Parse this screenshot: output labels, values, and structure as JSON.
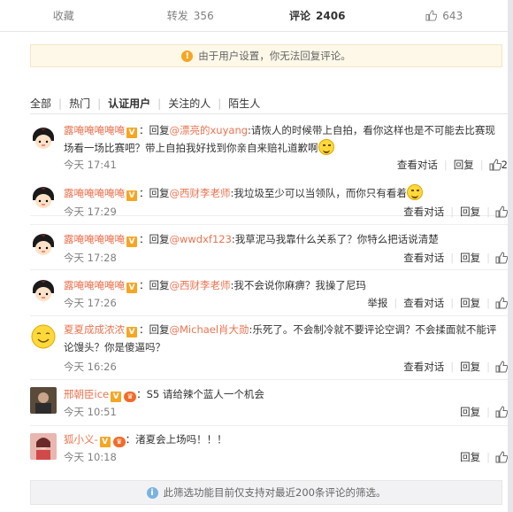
{
  "tabs": [
    {
      "label": "收藏",
      "count": ""
    },
    {
      "label": "转发",
      "count": "356"
    },
    {
      "label": "评论",
      "count": "2406"
    },
    {
      "label": "",
      "count": "643"
    }
  ],
  "notice": "由于用户设置，你无法回复评论。",
  "filters": [
    "全部",
    "热门",
    "认证用户",
    "关注的人",
    "陌生人"
  ],
  "comments": [
    {
      "user": "露唵唵唵唵唵",
      "text_pre": "：回复",
      "mention": "@漂亮的xuyang",
      "text": ":请恢人的时候带上自拍，看你这样也是不可能去比赛现场看一场比赛吧？带上自拍我好找到你亲自来赔礼道歉啊",
      "time": "今天 17:41",
      "actions": [
        "查看对话",
        "回复"
      ],
      "likes": "2"
    },
    {
      "user": "露唵唵唵唵唵",
      "text_pre": "：回复",
      "mention": "@西财李老师",
      "text": ":我垃圾至少可以当领队，而你只有看着",
      "time": "今天 17:29",
      "actions": [
        "查看对话",
        "回复"
      ],
      "likes": ""
    },
    {
      "user": "露唵唵唵唵唵",
      "text_pre": "：回复",
      "mention": "@wwdxf123",
      "text": ":我草泥马我靠什么关系了？你特么把话说清楚",
      "time": "今天 17:28",
      "actions": [
        "查看对话",
        "回复"
      ],
      "likes": ""
    },
    {
      "user": "露唵唵唵唵唵",
      "text_pre": "：回复",
      "mention": "@西财李老师",
      "text": ":我不会说你麻痹？我操了尼玛",
      "time": "今天 17:26",
      "actions": [
        "举报",
        "查看对话",
        "回复"
      ],
      "likes": ""
    },
    {
      "user": "夏夏成成浓浓",
      "text_pre": "：回复",
      "mention": "@Michael肖大勋",
      "text": ":乐死了。不会制冷就不要评论空调？不会揉面就不能评论馒头？你是傻逼吗？",
      "time": "今天 16:26",
      "actions": [
        "查看对话",
        "回复"
      ],
      "likes": ""
    },
    {
      "user": "邢朝臣ice",
      "text_pre": "",
      "mention": "",
      "text": "：S5 请给辣个蓝人一个机会",
      "time": "今天 10:51",
      "actions": [
        "回复"
      ],
      "likes": ""
    },
    {
      "user": "狐小义-",
      "text_pre": "",
      "mention": "",
      "text": "：渚夏会上场吗！！！",
      "time": "今天 10:18",
      "actions": [
        "回复"
      ],
      "likes": ""
    }
  ],
  "footer_note": "此筛选功能目前仅支持对最近200条评论的筛选。",
  "colors": {
    "link": "#eb7350",
    "notice_bg": "#fdf8e8",
    "vip": "#f5a623"
  }
}
